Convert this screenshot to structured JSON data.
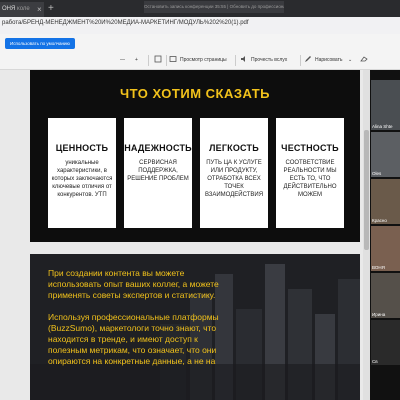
{
  "browser": {
    "tab_title": "ОНЯ",
    "tab_subtitle": "коле",
    "notification": "Остановить запись конференции 35:55 | Обновить до профессиональной версии",
    "url": "работа/БРЕНД-МЕНЕДЖМЕНТ%20И%20МЕДИА-МАРКЕТИНГ/МОДУЛЬ%202%20(1).pdf"
  },
  "toolbar": {
    "primary_button": "Использовать по умолчанию",
    "view_page": "Просмотр страницы",
    "read_aloud": "Прочесть вслух",
    "draw": "Нарисовать"
  },
  "slide1": {
    "title": "ЧТО ХОТИМ СКАЗАТЬ",
    "cards": [
      {
        "heading": "ЦЕННОСТЬ",
        "body": "уникальные характеристики, в которых заключаются ключевые отличия от конкурентов. УТП"
      },
      {
        "heading": "НАДЕЖНОСТЬ",
        "body": "СЕРВИСНАЯ ПОДДЕРЖКА, РЕШЕНИЕ ПРОБЛЕМ"
      },
      {
        "heading": "ЛЕГКОСТЬ",
        "body": "ПУТЬ ЦА К УСЛУГЕ ИЛИ ПРОДУКТУ, ОТРАБОТКА ВСЕХ ТОЧЕК ВЗАИМОДЕЙСТВИЯ"
      },
      {
        "heading": "ЧЕСТНОСТЬ",
        "body": "СООТВЕТСТВИЕ РЕАЛЬНОСТИ МЫ ЕСТЬ ТО, ЧТО ДЕЙСТВИТЕЛЬНО МОЖЕМ"
      }
    ]
  },
  "slide2": {
    "paragraph1": "При создании контента вы можете использовать опыт ваших коллег, а можете применять советы экспертов и статистику.",
    "paragraph2": "Используя профессиональные платформы (BuzzSumo), маркетологи точно знают, что находится в тренде, и имеют доступ к  полезным метрикам, что означает, что они опираются на конкретные данные, а не на"
  },
  "participants": [
    {
      "name": "Alina Shte"
    },
    {
      "name": "Oles"
    },
    {
      "name": "Красно"
    },
    {
      "name": "ВОНЯ"
    },
    {
      "name": "Ирина"
    },
    {
      "name": "Св"
    }
  ],
  "colors": {
    "accent_yellow": "#f2c21b",
    "primary_blue": "#1473e6",
    "slide_bg": "#0d0d0d"
  }
}
